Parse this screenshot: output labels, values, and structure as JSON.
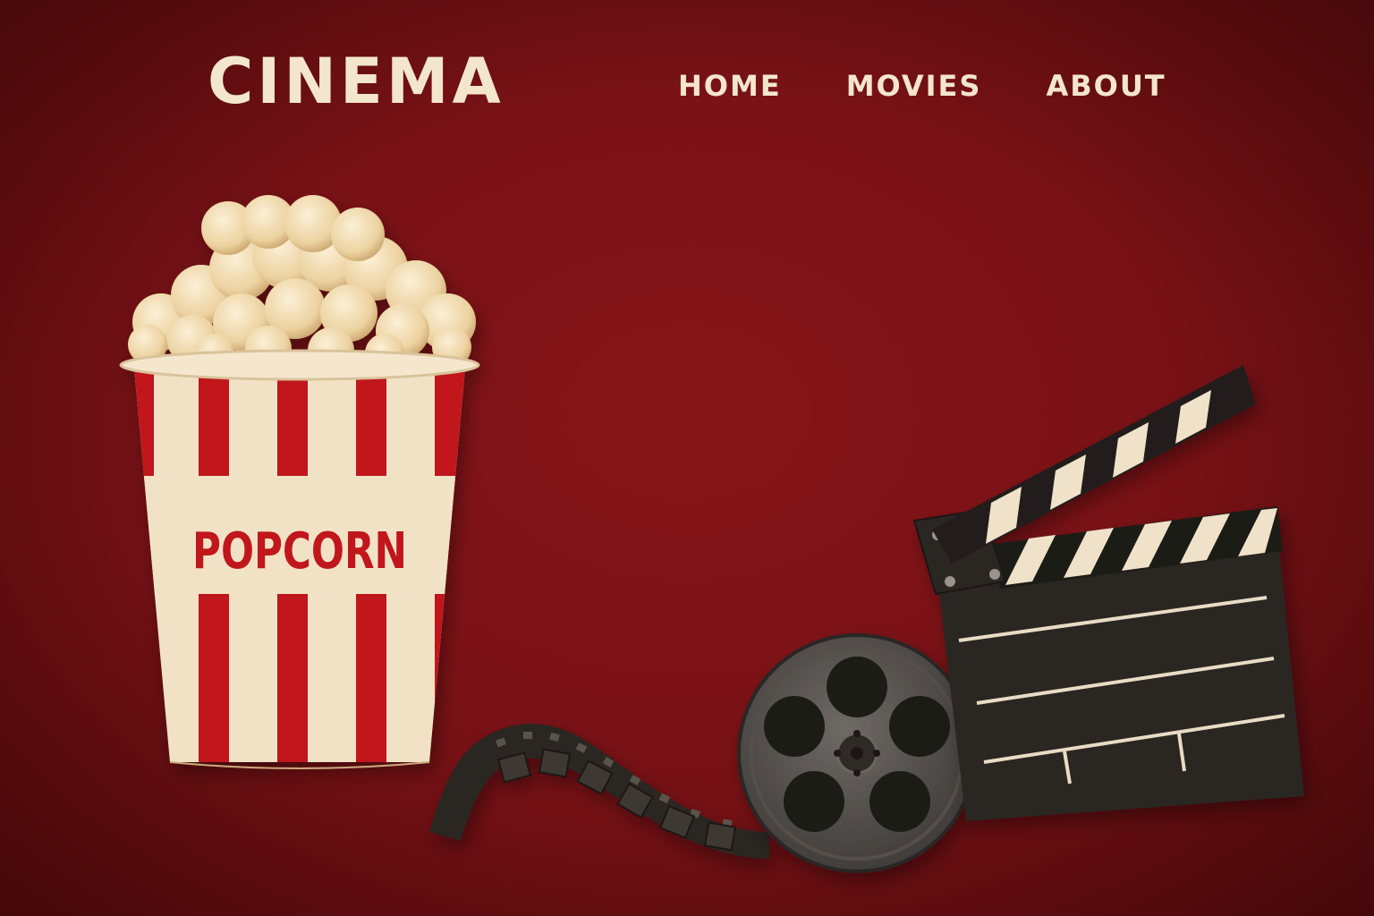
{
  "header": {
    "brand": "CINEMA",
    "nav": [
      {
        "label": "HOME"
      },
      {
        "label": "MOVIES"
      },
      {
        "label": "ABOUT"
      }
    ]
  },
  "hero": {
    "popcorn_label": "POPCORN",
    "icons": [
      "popcorn-bucket-icon",
      "film-strip-icon",
      "film-reel-icon",
      "clapperboard-icon"
    ]
  },
  "colors": {
    "background": "#7a1216",
    "cream": "#f3e6cd",
    "stripe_red": "#c0181e",
    "dark": "#2a2522"
  }
}
